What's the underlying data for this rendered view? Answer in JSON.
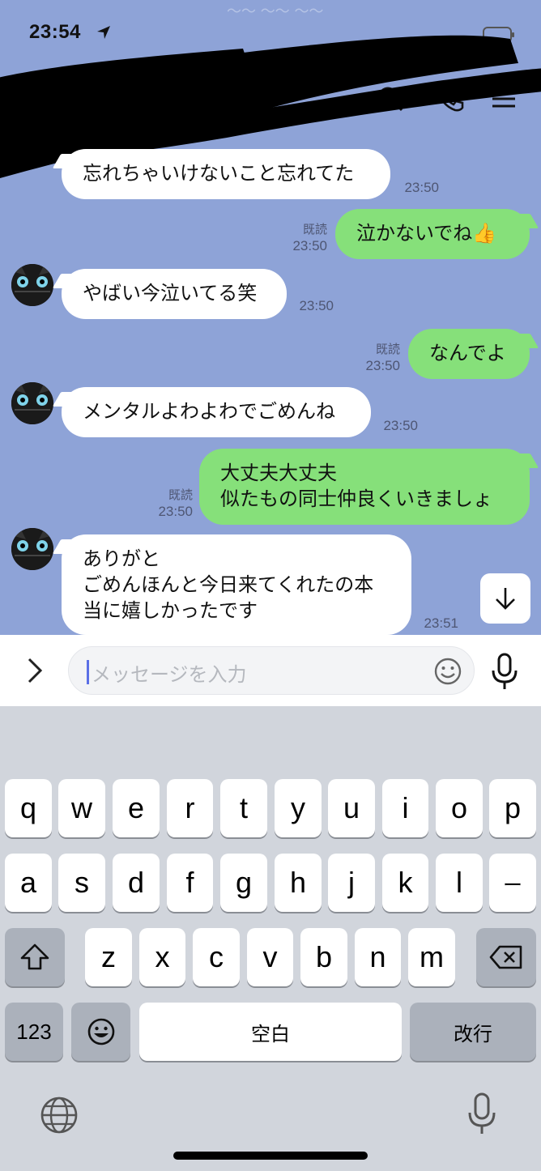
{
  "status": {
    "time": "23:54"
  },
  "chat": {
    "ghost_text": "～～ ～～ ～～",
    "messages": [
      {
        "side": "in",
        "text": "忘れちゃいけないこと忘れてた",
        "time": "23:50",
        "read": ""
      },
      {
        "side": "out",
        "text": "泣かないでね👍",
        "time": "23:50",
        "read": "既読"
      },
      {
        "side": "in",
        "text": "やばい今泣いてる笑",
        "time": "23:50",
        "read": ""
      },
      {
        "side": "out",
        "text": "なんでよ",
        "time": "23:50",
        "read": "既読"
      },
      {
        "side": "in",
        "text": "メンタルよわよわでごめんね",
        "time": "23:50",
        "read": ""
      },
      {
        "side": "out",
        "text": "大丈夫大丈夫\n似たもの同士仲良くいきましょ",
        "time": "23:50",
        "read": "既読"
      },
      {
        "side": "in",
        "text": "ありがと\nごめんほんと今日来てくれたの本\n当に嬉しかったです",
        "time": "23:51",
        "read": ""
      }
    ]
  },
  "input": {
    "placeholder": "メッセージを入力"
  },
  "keyboard": {
    "row1": [
      "q",
      "w",
      "e",
      "r",
      "t",
      "y",
      "u",
      "i",
      "o",
      "p"
    ],
    "row2": [
      "a",
      "s",
      "d",
      "f",
      "g",
      "h",
      "j",
      "k",
      "l",
      "ー"
    ],
    "row3": [
      "z",
      "x",
      "c",
      "v",
      "b",
      "n",
      "m"
    ],
    "numbers_label": "123",
    "space_label": "空白",
    "return_label": "改行"
  },
  "colors": {
    "chat_bg": "#8ea3d7",
    "outgoing_bubble": "#86e07a",
    "incoming_bubble": "#ffffff"
  }
}
